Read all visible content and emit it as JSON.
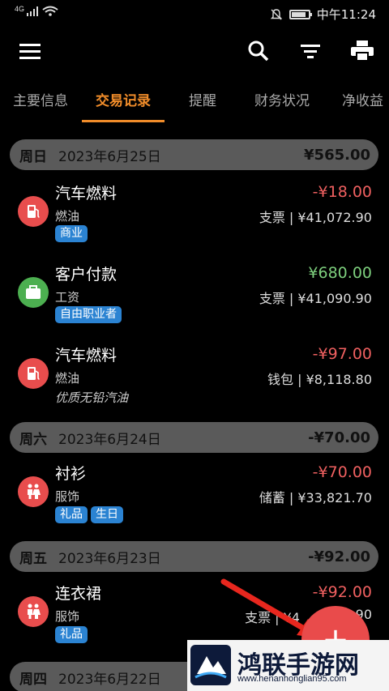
{
  "status_bar": {
    "network": "4G",
    "time": "中午11:24",
    "battery_level": 0.85
  },
  "toolbar": {
    "menu_icon": "menu-icon",
    "search_icon": "search-icon",
    "filter_icon": "filter-icon",
    "print_icon": "print-icon"
  },
  "tabs": [
    {
      "label": "主要信息",
      "active": false
    },
    {
      "label": "交易记录",
      "active": true
    },
    {
      "label": "提醒",
      "active": false
    },
    {
      "label": "财务状况",
      "active": false
    },
    {
      "label": "净收益",
      "active": false
    }
  ],
  "groups": [
    {
      "weekday": "周日",
      "date": "2023年6月25日",
      "total": "¥565.00",
      "transactions": [
        {
          "title": "汽车燃料",
          "category": "燃油",
          "amount": "-¥18.00",
          "amount_color": "#f06060",
          "account": "支票 | ¥41,072.90",
          "tags": [
            "商业"
          ],
          "note": "",
          "icon": "fuel-icon",
          "icon_color": "#e84d4d"
        },
        {
          "title": "客户付款",
          "category": "工资",
          "amount": "¥680.00",
          "amount_color": "#7ed07e",
          "account": "支票 | ¥41,090.90",
          "tags": [
            "自由职业者"
          ],
          "note": "",
          "icon": "briefcase-icon",
          "icon_color": "#4caf50"
        },
        {
          "title": "汽车燃料",
          "category": "燃油",
          "amount": "-¥97.00",
          "amount_color": "#f06060",
          "account": "钱包 | ¥8,118.80",
          "tags": [],
          "note": "优质无铅汽油",
          "icon": "fuel-icon",
          "icon_color": "#e84d4d"
        }
      ]
    },
    {
      "weekday": "周六",
      "date": "2023年6月24日",
      "total": "-¥70.00",
      "transactions": [
        {
          "title": "衬衫",
          "category": "服饰",
          "amount": "-¥70.00",
          "amount_color": "#f06060",
          "account": "储蓄 | ¥33,821.70",
          "tags": [
            "礼品",
            "生日"
          ],
          "note": "",
          "icon": "clothing-icon",
          "icon_color": "#e84d4d"
        }
      ]
    },
    {
      "weekday": "周五",
      "date": "2023年6月23日",
      "total": "-¥92.00",
      "transactions": [
        {
          "title": "连衣裙",
          "category": "服饰",
          "amount": "-¥92.00",
          "amount_color": "#f06060",
          "account": "支票 | ¥4",
          "account_tail": "90",
          "tags": [
            "礼品"
          ],
          "note": "",
          "icon": "clothing-icon",
          "icon_color": "#e84d4d"
        }
      ]
    },
    {
      "weekday": "周四",
      "date": "2023年6月22日",
      "total": "",
      "transactions": []
    }
  ],
  "fab": {
    "label": "+",
    "icon": "add-icon",
    "color": "#e94b4b"
  },
  "watermark": {
    "title": "鸿联手游网",
    "url": "www.henanhonglian95.com"
  }
}
